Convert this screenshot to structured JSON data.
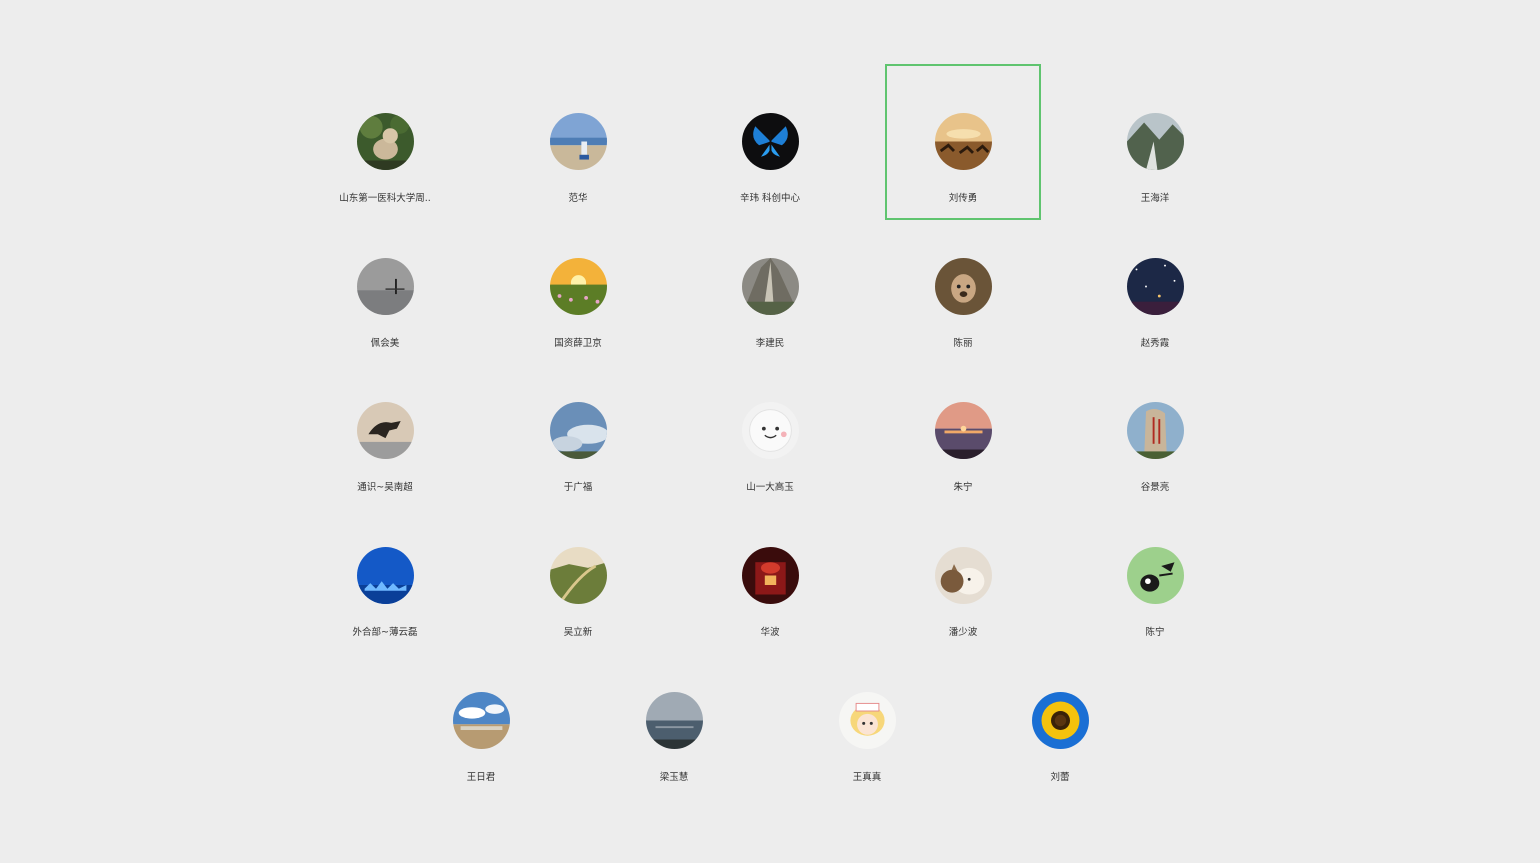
{
  "contacts": [
    {
      "name": "山东第一医科大学周..",
      "avatar": "bear-photo",
      "selected": false
    },
    {
      "name": "范华",
      "avatar": "beach-photo",
      "selected": false
    },
    {
      "name": "辛玮 科创中心",
      "avatar": "butterfly-photo",
      "selected": false
    },
    {
      "name": "刘传勇",
      "avatar": "sunset-desert-photo",
      "selected": true
    },
    {
      "name": "王海洋",
      "avatar": "mountain-photo",
      "selected": false
    },
    {
      "name": "佩会美",
      "avatar": "foggy-pier-photo",
      "selected": false
    },
    {
      "name": "国资薛卫京",
      "avatar": "sunset-field-photo",
      "selected": false
    },
    {
      "name": "李建民",
      "avatar": "great-wall-photo",
      "selected": false
    },
    {
      "name": "陈丽",
      "avatar": "dog-photo",
      "selected": false
    },
    {
      "name": "赵秀霞",
      "avatar": "night-sky-photo",
      "selected": false
    },
    {
      "name": "通识~吴南超",
      "avatar": "horse-sculpture-photo",
      "selected": false
    },
    {
      "name": "于广福",
      "avatar": "sky-clouds-photo",
      "selected": false
    },
    {
      "name": "山一大高玉",
      "avatar": "smiley-ball-photo",
      "selected": false
    },
    {
      "name": "朱宁",
      "avatar": "sea-sunset-photo",
      "selected": false
    },
    {
      "name": "谷景亮",
      "avatar": "stone-monument-photo",
      "selected": false
    },
    {
      "name": "外合部~薄云磊",
      "avatar": "blue-city-photo",
      "selected": false
    },
    {
      "name": "吴立新",
      "avatar": "valley-photo",
      "selected": false
    },
    {
      "name": "华波",
      "avatar": "red-lantern-photo",
      "selected": false
    },
    {
      "name": "潘少波",
      "avatar": "cat-photo",
      "selected": false
    },
    {
      "name": "陈宁",
      "avatar": "cartoon-bird-photo",
      "selected": false
    },
    {
      "name": "王日君",
      "avatar": "seaside-village-photo",
      "selected": false
    },
    {
      "name": "梁玉慧",
      "avatar": "lake-photo",
      "selected": false
    },
    {
      "name": "王真真",
      "avatar": "cartoon-girl-photo",
      "selected": false
    },
    {
      "name": "刘蕾",
      "avatar": "sunflower-photo",
      "selected": false
    }
  ]
}
